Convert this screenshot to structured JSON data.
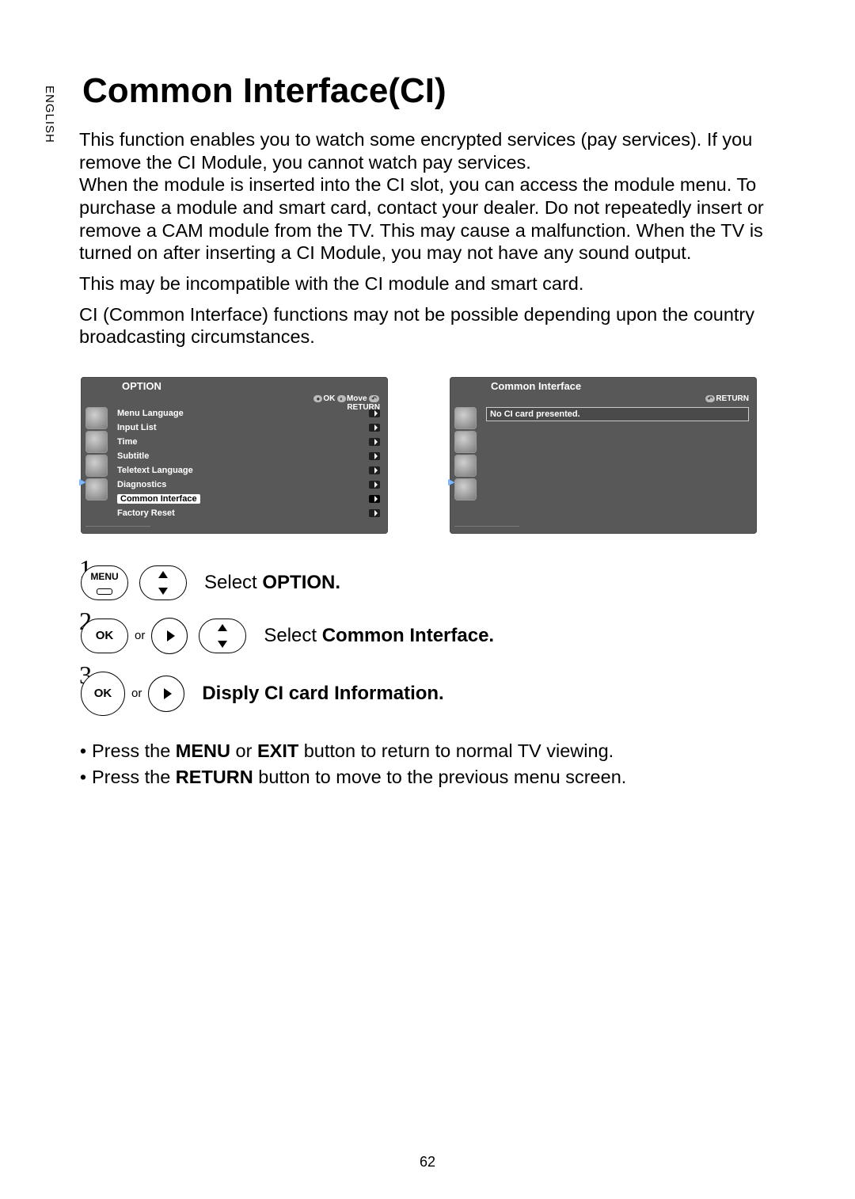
{
  "language_tab": "ENGLISH",
  "title": "Common Interface(CI)",
  "paragraphs": {
    "p1": "This function enables you to watch some encrypted services (pay services). If you remove the CI Module, you cannot watch pay services.",
    "p2": "When the module is inserted into the CI slot, you can access the module menu. To purchase a module and smart card, contact your dealer. Do not repeatedly insert or remove a CAM module from the TV. This may cause a malfunction. When the TV is turned on after inserting a CI Module, you may not have any sound output.",
    "p3": "This may be incompatible with the CI module and smart card.",
    "p4": "CI (Common Interface) functions may not be possible depending upon the country broadcasting circumstances."
  },
  "screenshot_left": {
    "title": "OPTION",
    "hint_ok": "OK",
    "hint_move": "Move",
    "hint_return": "RETURN",
    "items": [
      "Menu Language",
      "Input List",
      "Time",
      "Subtitle",
      "Teletext Language",
      "Diagnostics",
      "Common Interface",
      "Factory Reset"
    ],
    "selected_index": 6
  },
  "screenshot_right": {
    "title": "Common Interface",
    "hint_return": "RETURN",
    "message": "No CI card presented."
  },
  "steps": {
    "s1_num": "1",
    "s1_btn": "MENU",
    "s1_text_pre": "Select ",
    "s1_text_bold": "OPTION.",
    "s2_num": "2",
    "s2_btn": "OK",
    "s2_or": "or",
    "s2_text_pre": "Select ",
    "s2_text_bold": "Common Interface.",
    "s3_num": "3",
    "s3_btn": "OK",
    "s3_or": "or",
    "s3_text_bold": "Disply CI card Information."
  },
  "footer": {
    "b1_pre": "Press the ",
    "b1_b1": "MENU",
    "b1_mid": " or ",
    "b1_b2": "EXIT",
    "b1_post": " button to return to normal TV viewing.",
    "b2_pre": "Press the ",
    "b2_b1": "RETURN",
    "b2_post": " button to move to the previous menu screen."
  },
  "page_number": "62"
}
